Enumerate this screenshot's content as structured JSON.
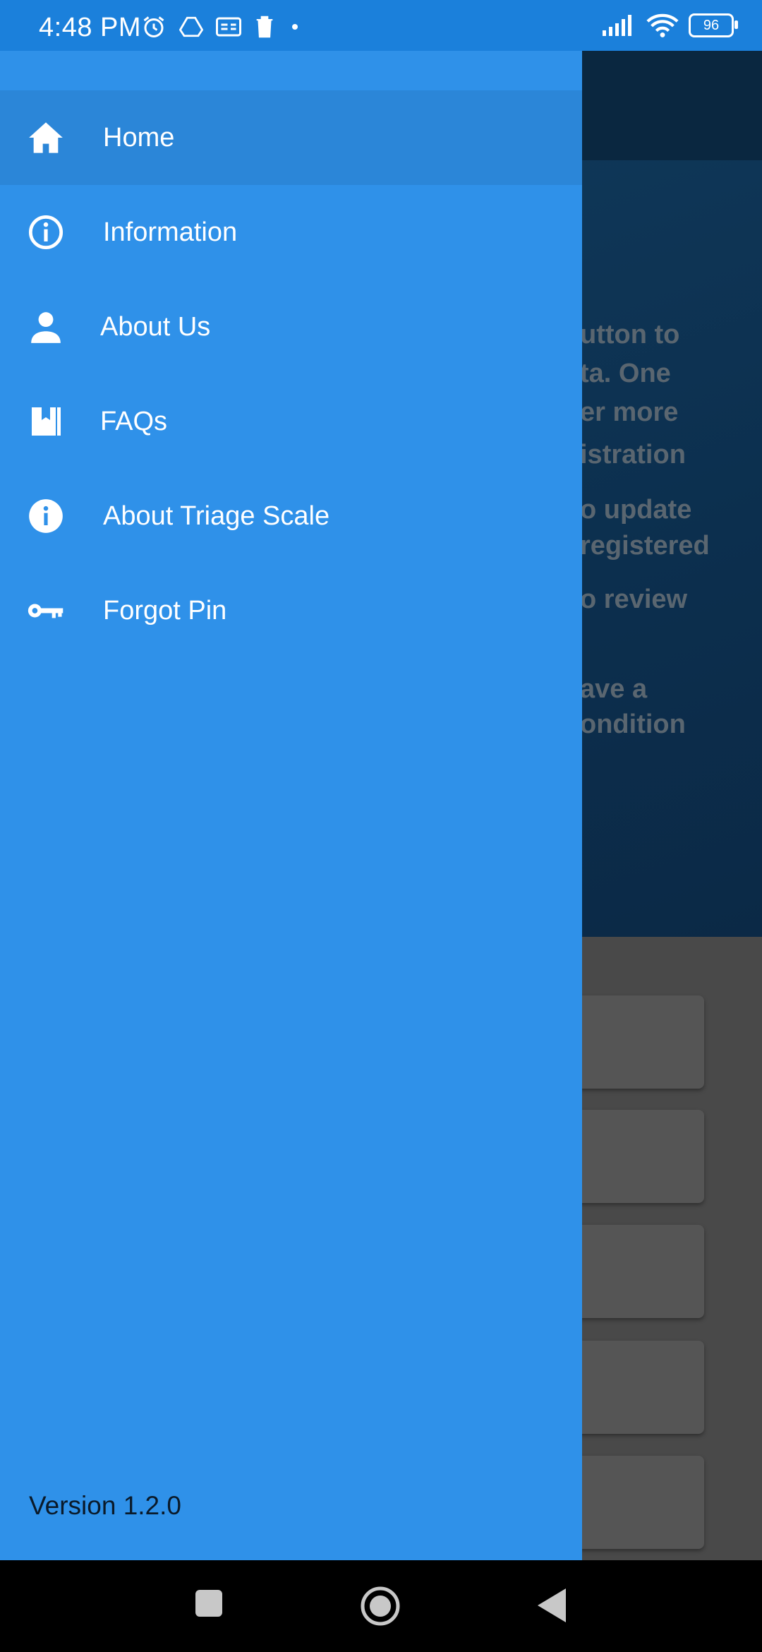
{
  "status_bar": {
    "time": "4:48 PM",
    "battery": "96"
  },
  "background": {
    "hero_lines": [
      "utton to",
      "ta. One",
      "er more",
      "istration",
      "o update",
      "registered",
      "o review",
      "ave a",
      "ondition"
    ]
  },
  "drawer": {
    "items": [
      {
        "label": "Home",
        "icon": "home-icon"
      },
      {
        "label": "Information",
        "icon": "info-outline-icon"
      },
      {
        "label": "About Us",
        "icon": "person-icon"
      },
      {
        "label": "FAQs",
        "icon": "book-icon"
      },
      {
        "label": "About Triage Scale",
        "icon": "info-filled-icon"
      },
      {
        "label": "Forgot Pin",
        "icon": "key-icon"
      }
    ],
    "version": "Version 1.2.0"
  },
  "colors": {
    "drawer": "#2f91e9",
    "active_item": "#2b86d8",
    "status_bar": "#1b80db"
  }
}
